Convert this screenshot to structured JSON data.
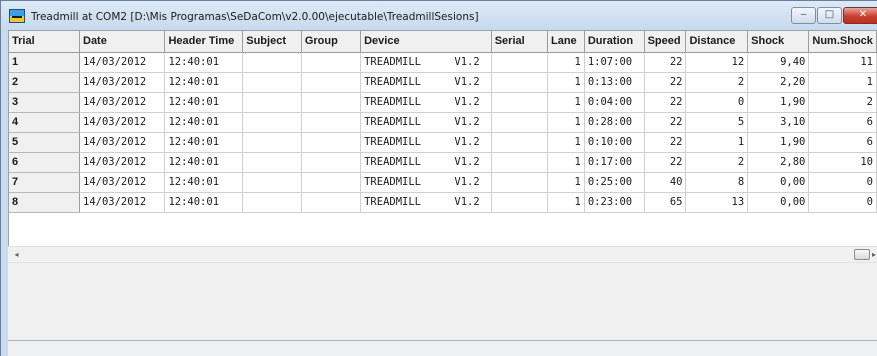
{
  "window": {
    "title": "Treadmill at COM2  [D:\\Mis Programas\\SeDaCom\\v2.0.00\\ejecutable\\TreadmillSesions]",
    "buttons": {
      "minimize": "‒",
      "maximize": "□",
      "close": "✕"
    }
  },
  "table": {
    "columns": [
      "Trial",
      "Date",
      "Header Time",
      "Subject",
      "Group",
      "Device",
      "Serial",
      "Lane",
      "Duration",
      "Speed",
      "Distance",
      "Shock",
      "Num.Shock"
    ],
    "rows": [
      {
        "trial": "1",
        "date": "14/03/2012",
        "time": "12:40:01",
        "subject": "",
        "group": "",
        "device": "TREADMILL",
        "version": "V1.2",
        "serial": "",
        "lane": "1",
        "duration": "1:07:00",
        "speed": "22",
        "distance": "12",
        "shock": "9,40",
        "num_shock": "11"
      },
      {
        "trial": "2",
        "date": "14/03/2012",
        "time": "12:40:01",
        "subject": "",
        "group": "",
        "device": "TREADMILL",
        "version": "V1.2",
        "serial": "",
        "lane": "1",
        "duration": "0:13:00",
        "speed": "22",
        "distance": "2",
        "shock": "2,20",
        "num_shock": "1"
      },
      {
        "trial": "3",
        "date": "14/03/2012",
        "time": "12:40:01",
        "subject": "",
        "group": "",
        "device": "TREADMILL",
        "version": "V1.2",
        "serial": "",
        "lane": "1",
        "duration": "0:04:00",
        "speed": "22",
        "distance": "0",
        "shock": "1,90",
        "num_shock": "2"
      },
      {
        "trial": "4",
        "date": "14/03/2012",
        "time": "12:40:01",
        "subject": "",
        "group": "",
        "device": "TREADMILL",
        "version": "V1.2",
        "serial": "",
        "lane": "1",
        "duration": "0:28:00",
        "speed": "22",
        "distance": "5",
        "shock": "3,10",
        "num_shock": "6"
      },
      {
        "trial": "5",
        "date": "14/03/2012",
        "time": "12:40:01",
        "subject": "",
        "group": "",
        "device": "TREADMILL",
        "version": "V1.2",
        "serial": "",
        "lane": "1",
        "duration": "0:10:00",
        "speed": "22",
        "distance": "1",
        "shock": "1,90",
        "num_shock": "6"
      },
      {
        "trial": "6",
        "date": "14/03/2012",
        "time": "12:40:01",
        "subject": "",
        "group": "",
        "device": "TREADMILL",
        "version": "V1.2",
        "serial": "",
        "lane": "1",
        "duration": "0:17:00",
        "speed": "22",
        "distance": "2",
        "shock": "2,80",
        "num_shock": "10"
      },
      {
        "trial": "7",
        "date": "14/03/2012",
        "time": "12:40:01",
        "subject": "",
        "group": "",
        "device": "TREADMILL",
        "version": "V1.2",
        "serial": "",
        "lane": "1",
        "duration": "0:25:00",
        "speed": "40",
        "distance": "8",
        "shock": "0,00",
        "num_shock": "0"
      },
      {
        "trial": "8",
        "date": "14/03/2012",
        "time": "12:40:01",
        "subject": "",
        "group": "",
        "device": "TREADMILL",
        "version": "V1.2",
        "serial": "",
        "lane": "1",
        "duration": "0:23:00",
        "speed": "65",
        "distance": "13",
        "shock": "0,00",
        "num_shock": "0"
      }
    ]
  },
  "scrollbar": {
    "left_arrow": "◂",
    "right_arrow": "▸"
  },
  "colors": {
    "titlebar": "#c6d9ee",
    "close_button": "#c8402f",
    "header_bg": "#f0f0f0",
    "grid_bg": "#ffffff"
  },
  "icons": {
    "app": "treadmill-app-icon"
  }
}
